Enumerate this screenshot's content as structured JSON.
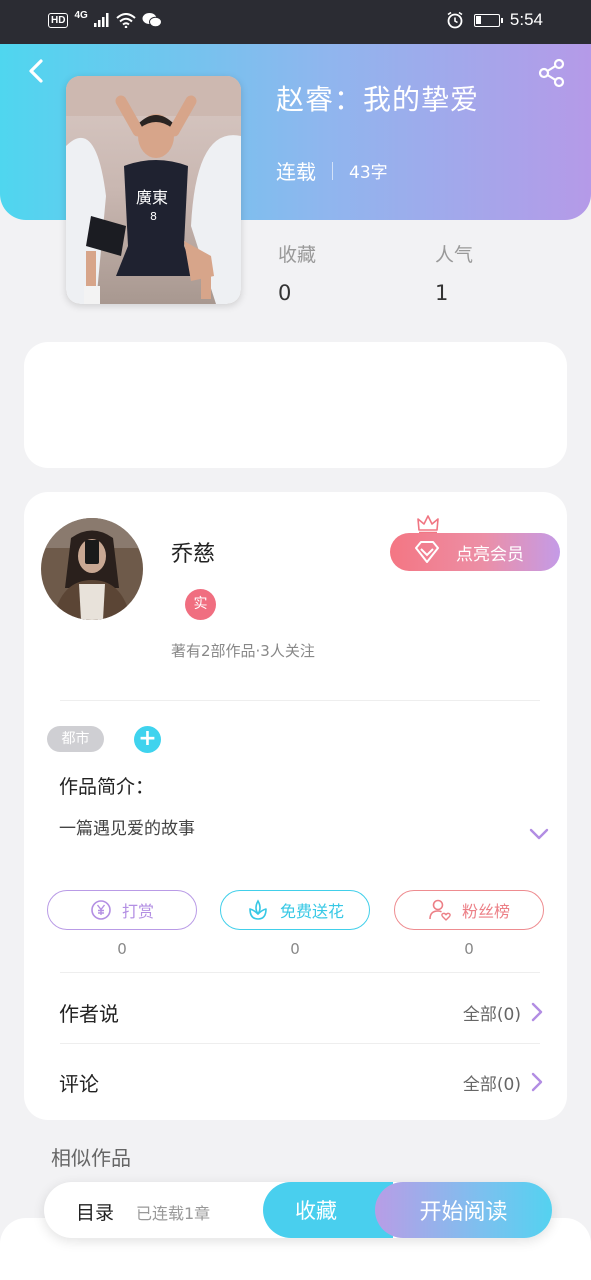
{
  "status_bar": {
    "hd": "HD",
    "net": "4G",
    "time": "5:54"
  },
  "book": {
    "title": "赵睿：我的挚爱",
    "status": "连载",
    "word_count": "43字"
  },
  "stats": {
    "favorites_label": "收藏",
    "favorites_value": "0",
    "popularity_label": "人气",
    "popularity_value": "1"
  },
  "author": {
    "name": "乔慈",
    "verified_badge": "实",
    "meta": "著有2部作品·3人关注",
    "vip_button": "点亮会员"
  },
  "tags": {
    "genre": "都市",
    "add": "+"
  },
  "intro": {
    "label": "作品简介：",
    "text": "一篇遇见爱的故事"
  },
  "actions": [
    {
      "label": "打赏",
      "count": "0",
      "icon": "yen-coin-icon"
    },
    {
      "label": "免费送花",
      "count": "0",
      "icon": "flower-icon"
    },
    {
      "label": "粉丝榜",
      "count": "0",
      "icon": "user-heart-icon"
    }
  ],
  "rows": {
    "author_says_label": "作者说",
    "author_says_value": "全部(0)",
    "comments_label": "评论",
    "comments_value": "全部(0)"
  },
  "similar_title": "相似作品",
  "bottom_bar": {
    "toc": "目录",
    "chapters": "已连载1章",
    "favorite": "收藏",
    "start_reading": "开始阅读"
  },
  "colors": {
    "header_start": "#4fd6ef",
    "header_end": "#b59ae8",
    "vip": "#f47683",
    "accent_cyan": "#41cfea",
    "accent_purple": "#b99be6",
    "accent_red": "#ee8c90"
  }
}
